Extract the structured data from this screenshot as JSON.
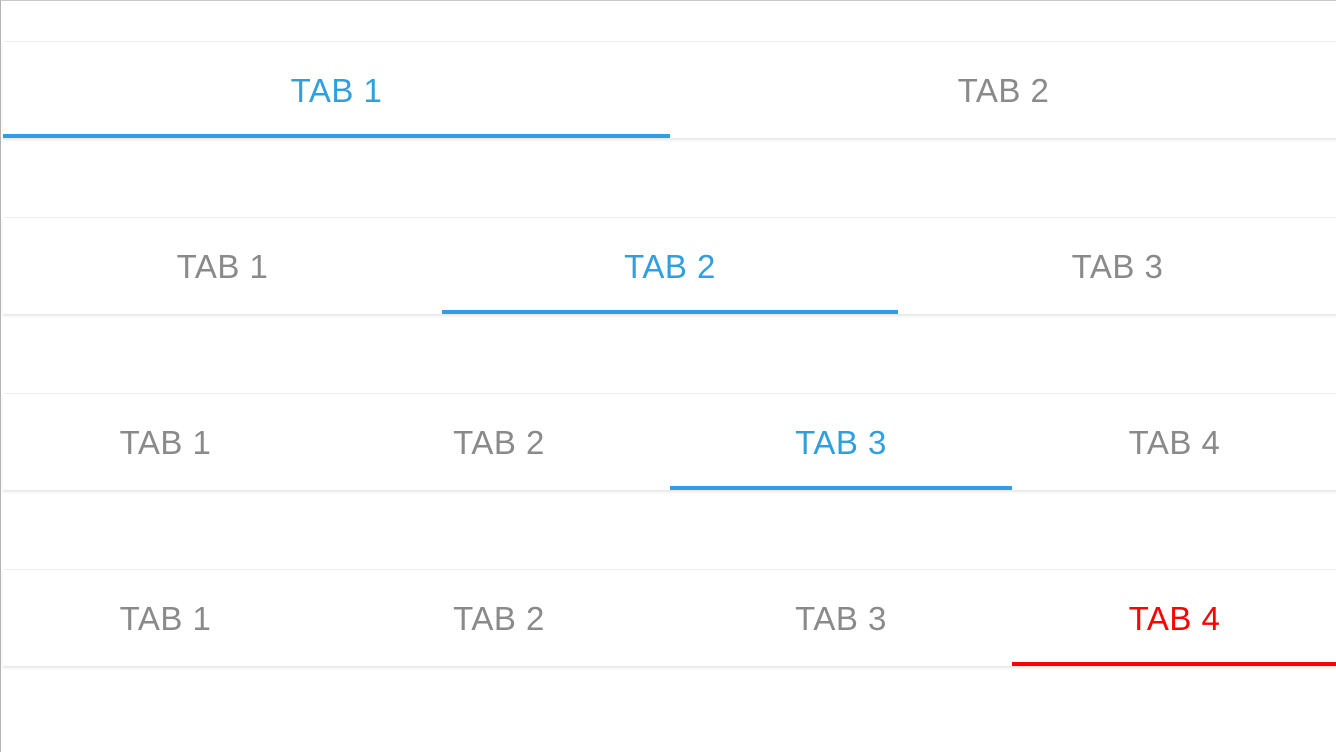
{
  "colors": {
    "active_blue": "#2f9fdf",
    "active_red": "#ff0000",
    "inactive_text": "#8a8a8a",
    "background": "#ffffff"
  },
  "tabbars": [
    {
      "tabs": [
        {
          "label": "TAB 1",
          "active": true
        },
        {
          "label": "TAB 2",
          "active": false
        }
      ]
    },
    {
      "tabs": [
        {
          "label": "TAB 1",
          "active": false
        },
        {
          "label": "TAB 2",
          "active": true
        },
        {
          "label": "TAB 3",
          "active": false
        }
      ]
    },
    {
      "tabs": [
        {
          "label": "TAB 1",
          "active": false
        },
        {
          "label": "TAB 2",
          "active": false
        },
        {
          "label": "TAB 3",
          "active": true
        },
        {
          "label": "TAB 4",
          "active": false
        }
      ]
    },
    {
      "tabs": [
        {
          "label": "TAB 1",
          "active": false
        },
        {
          "label": "TAB 2",
          "active": false
        },
        {
          "label": "TAB 3",
          "active": false
        },
        {
          "label": "TAB 4",
          "active": true,
          "accent": "red"
        }
      ]
    }
  ]
}
